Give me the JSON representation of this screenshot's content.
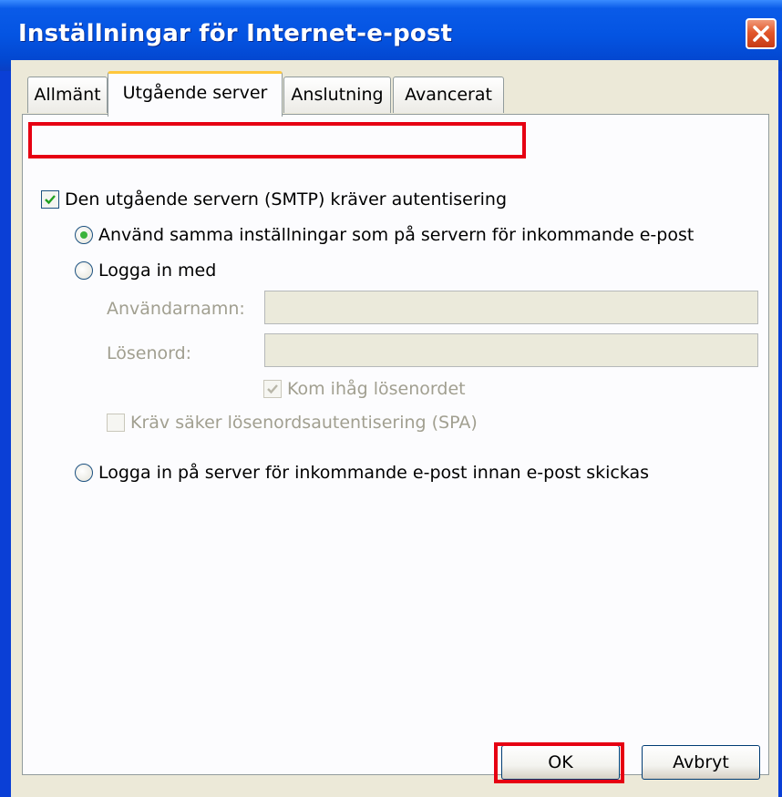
{
  "window": {
    "title": "Inställningar för Internet-e-post"
  },
  "tabs": [
    {
      "label": "Allmänt"
    },
    {
      "label": "Utgående server"
    },
    {
      "label": "Anslutning"
    },
    {
      "label": "Avancerat"
    }
  ],
  "outgoing": {
    "smtp_auth_label": "Den utgående servern (SMTP) kräver autentisering",
    "use_same_label": "Använd samma inställningar som på servern för inkommande e-post",
    "login_with_label": "Logga in med",
    "username_label": "Användarnamn:",
    "username_value": "",
    "password_label": "Lösenord:",
    "password_value": "",
    "remember_password_label": "Kom ihåg lösenordet",
    "spa_label": "Kräv säker lösenordsautentisering (SPA)",
    "login_before_send_label": "Logga in på server för inkommande e-post innan e-post skickas"
  },
  "buttons": {
    "ok": "OK",
    "cancel": "Avbryt"
  },
  "colors": {
    "highlight": "#e60012",
    "title_bar": "#0454e2",
    "dialog_bg": "#ece9d8"
  }
}
